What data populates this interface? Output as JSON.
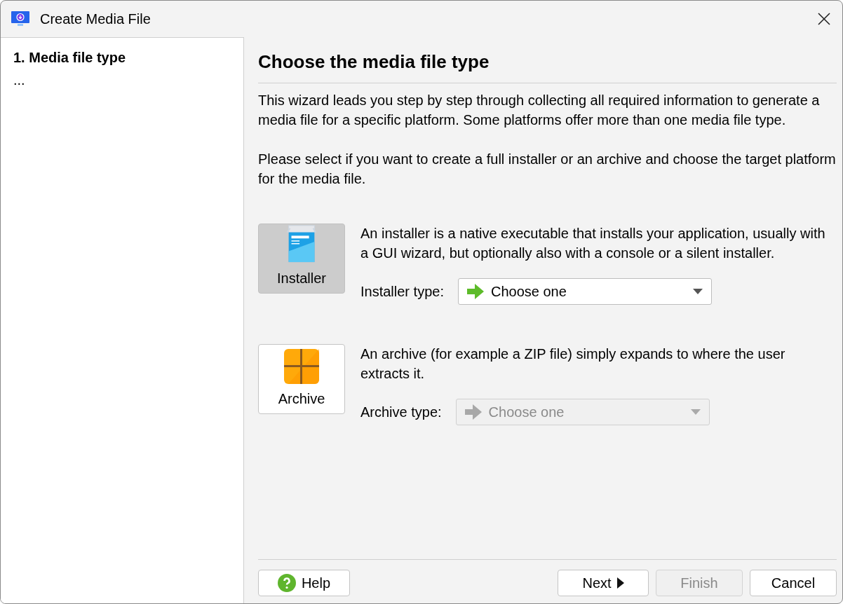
{
  "window": {
    "title": "Create Media File"
  },
  "steps": [
    {
      "label": "1. Media file type",
      "selected": true
    },
    {
      "label": "...",
      "selected": false
    }
  ],
  "page": {
    "heading": "Choose the media file type",
    "paragraphs": [
      "This wizard leads you step by step through collecting all required information to generate a media file for a specific platform. Some platforms offer more than one media file type.",
      "Please select if you want to create a full installer or an archive and choose the target platform for the media file."
    ]
  },
  "options": [
    {
      "kind": "installer",
      "label": "Installer",
      "selected": true,
      "description": "An installer is a native executable that installs your application, usually with a GUI wizard, but optionally also with a console or a silent installer.",
      "field_label": "Installer type:",
      "dropdown": {
        "value": "Choose one",
        "disabled": false
      }
    },
    {
      "kind": "archive",
      "label": "Archive",
      "selected": false,
      "description": "An archive (for example a ZIP file) simply expands to where the user extracts it.",
      "field_label": "Archive type:",
      "dropdown": {
        "value": "Choose one",
        "disabled": true
      }
    }
  ],
  "buttons": [
    {
      "kind": "help",
      "label": "Help",
      "disabled": false
    },
    {
      "kind": "next",
      "label": "Next",
      "disabled": false
    },
    {
      "kind": "finish",
      "label": "Finish",
      "disabled": true
    },
    {
      "kind": "cancel",
      "label": "Cancel",
      "disabled": false
    }
  ]
}
